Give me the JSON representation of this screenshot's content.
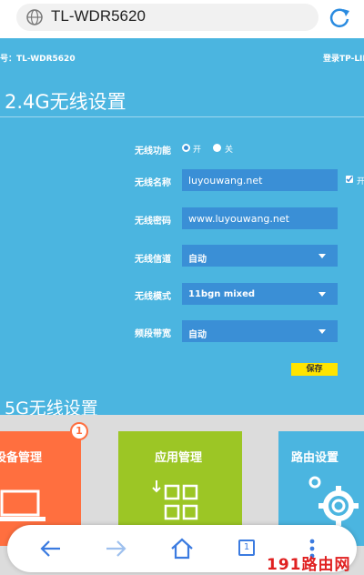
{
  "browser": {
    "url": "TL-WDR5620"
  },
  "router": {
    "model_label": "号：TL-WDR5620",
    "brand_label": "登录TP-LIN",
    "section_24g_title": "2.4G无线设置",
    "section_5g_title": "5G无线设置",
    "save_label": "保存",
    "wireless_function": {
      "label": "无线功能",
      "on_label": "开",
      "off_label": "关",
      "selected": "开"
    },
    "wireless_name": {
      "label": "无线名称",
      "value": "luyouwang.net",
      "side_label": "开"
    },
    "wireless_password": {
      "label": "无线密码",
      "value": "www.luyouwang.net"
    },
    "wireless_channel": {
      "label": "无线信道",
      "value": "自动"
    },
    "wireless_mode": {
      "label": "无线模式",
      "value": "11bgn mixed"
    },
    "bandwidth": {
      "label": "频段带宽",
      "value": "自动"
    }
  },
  "tiles": {
    "device": {
      "label": "设备管理",
      "badge": "1",
      "color": "#ff6f3f"
    },
    "apps": {
      "label": "应用管理",
      "color": "#9cc625"
    },
    "router_settings": {
      "label": "路由设置",
      "color": "#4bb5e0"
    }
  },
  "nav": {
    "tab_count": "1"
  },
  "watermark": "191路由网",
  "colors": {
    "accent": "#4bb5e0",
    "input_bg": "#3a8fd6",
    "save_button": "#ffe400"
  }
}
